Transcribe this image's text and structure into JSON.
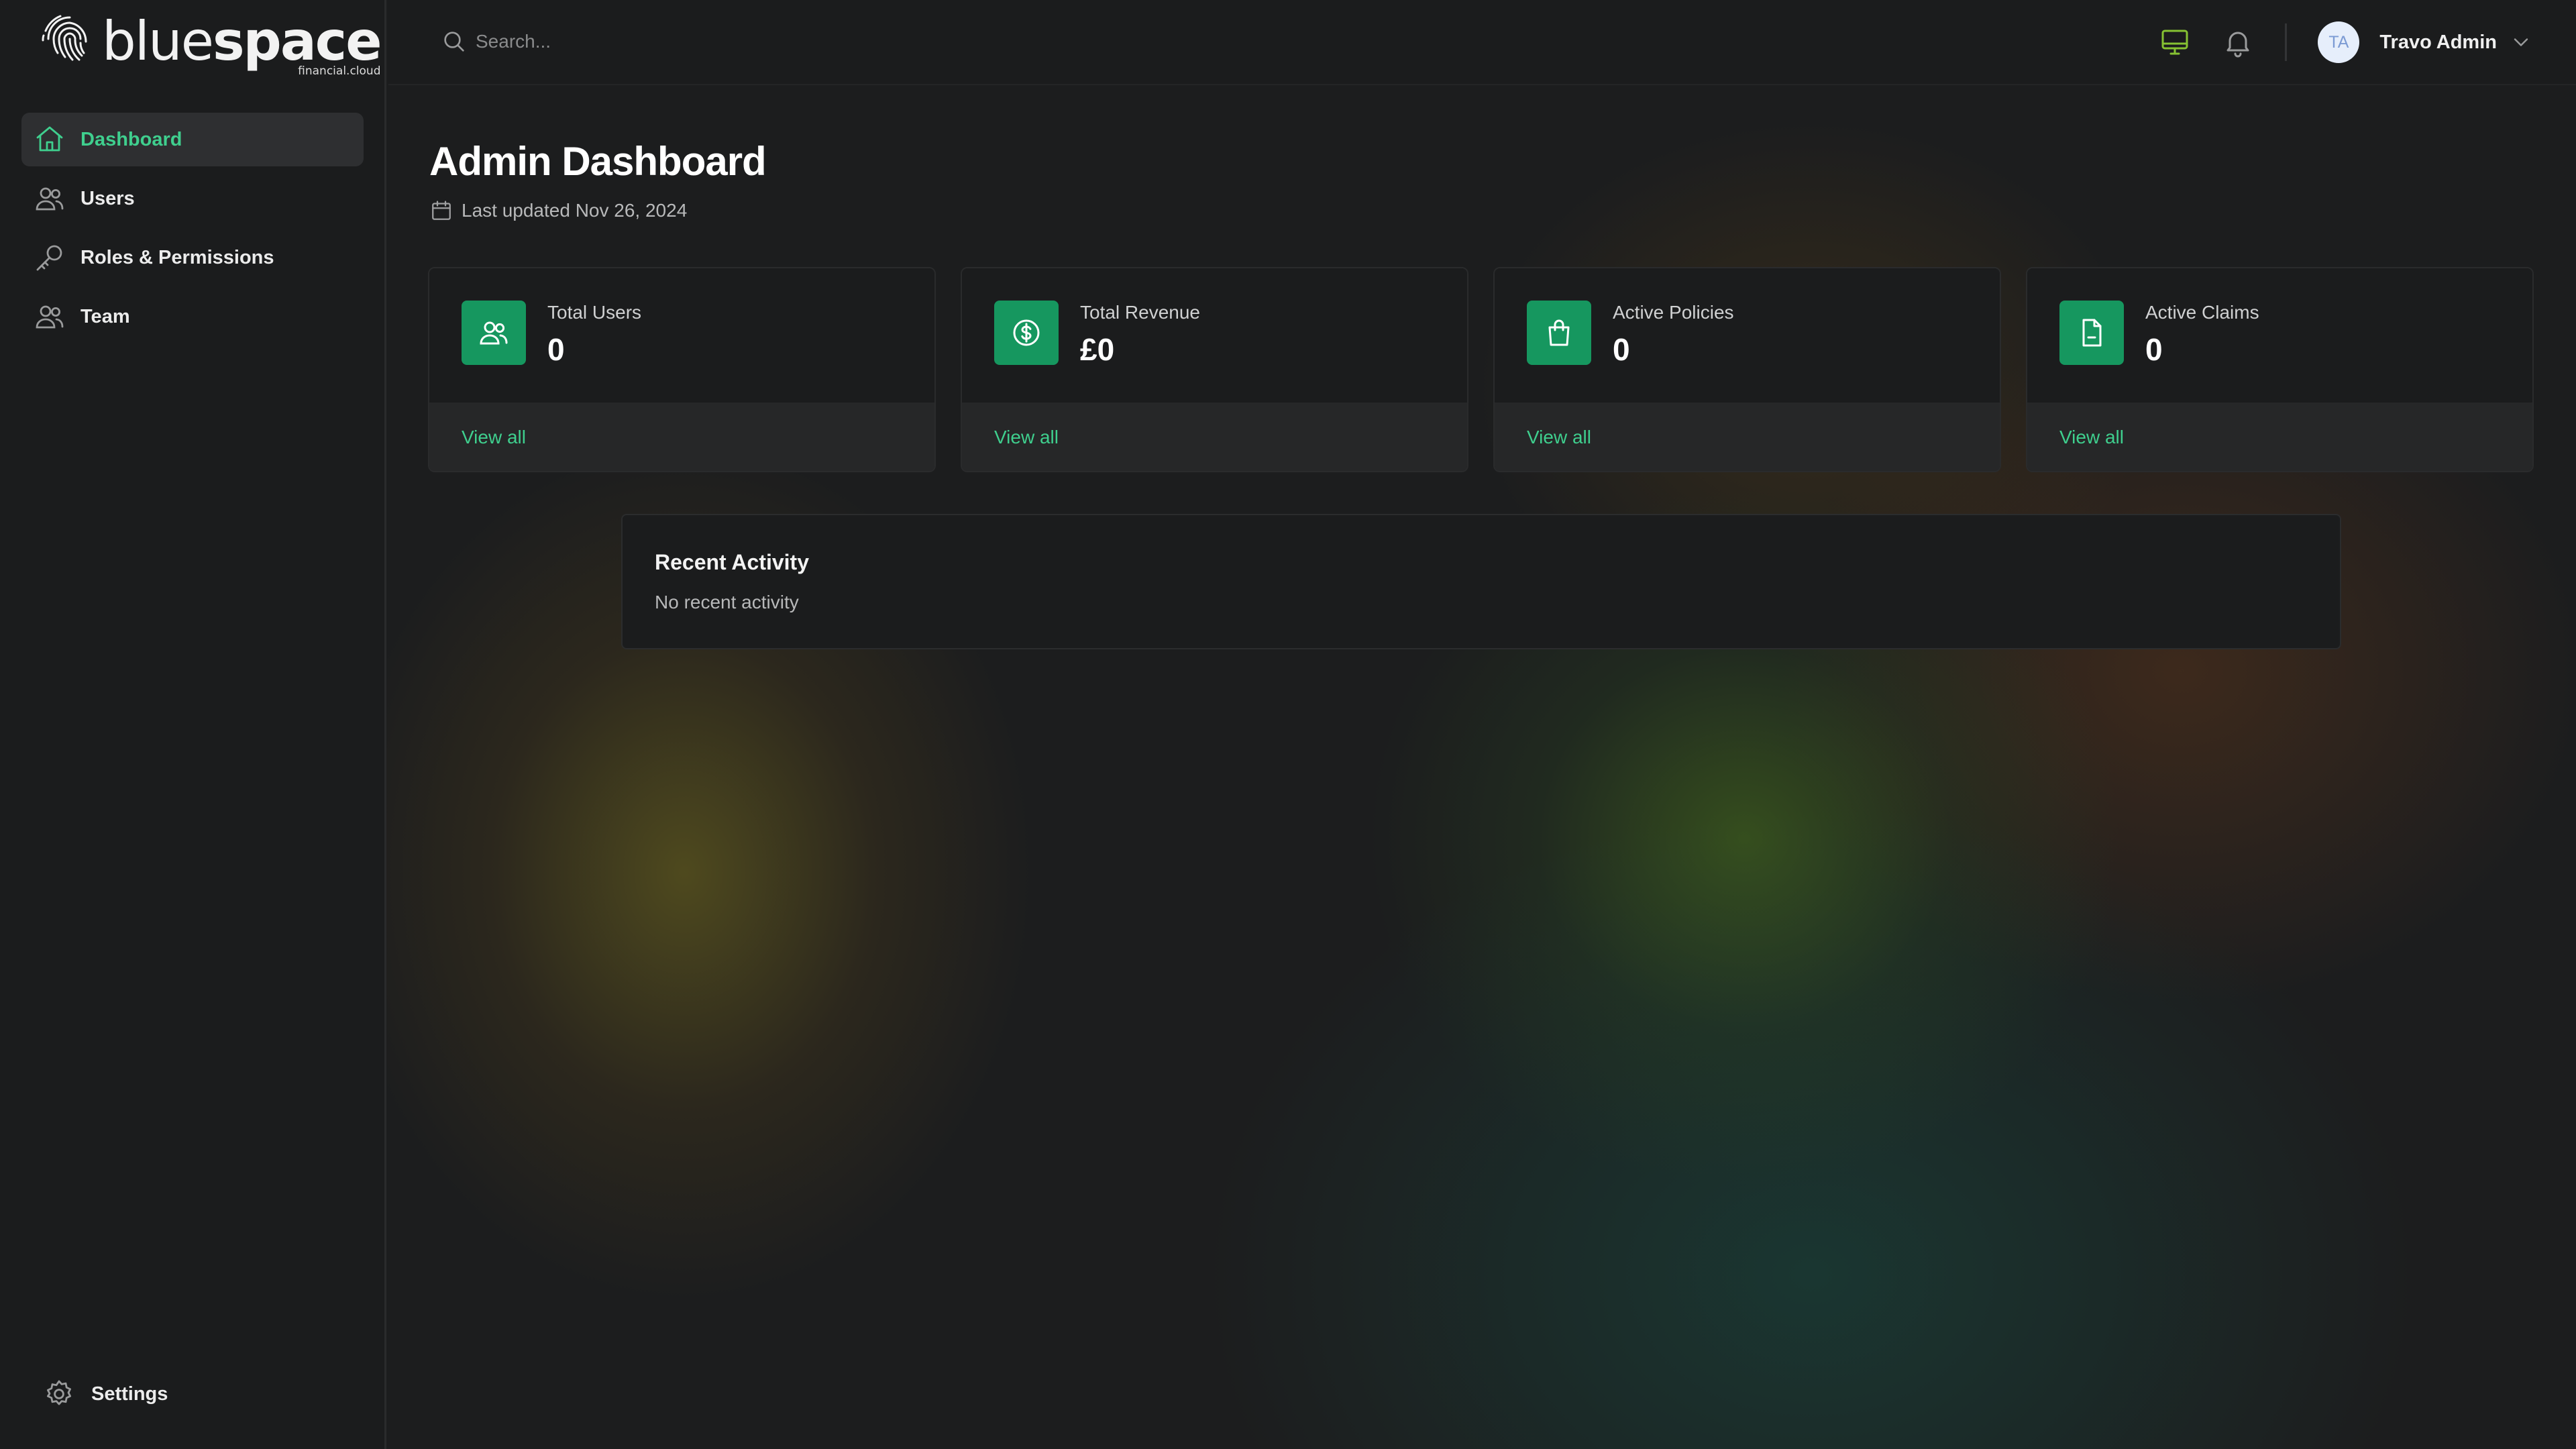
{
  "brand": {
    "logo_word_light": "blue",
    "logo_word_bold": "space",
    "logo_sub": "financial.cloud"
  },
  "sidebar": {
    "items": [
      {
        "label": "Dashboard",
        "icon": "home-icon",
        "active": true
      },
      {
        "label": "Users",
        "icon": "users-icon",
        "active": false
      },
      {
        "label": "Roles & Permissions",
        "icon": "key-icon",
        "active": false
      },
      {
        "label": "Team",
        "icon": "team-icon",
        "active": false
      }
    ],
    "settings_label": "Settings"
  },
  "topbar": {
    "search_placeholder": "Search...",
    "avatar_initials": "TA",
    "user_name": "Travo Admin"
  },
  "main": {
    "title": "Admin Dashboard",
    "last_updated": "Last updated Nov 26, 2024",
    "cards": [
      {
        "label": "Total Users",
        "value": "0",
        "link": "View all",
        "icon": "users-icon"
      },
      {
        "label": "Total Revenue",
        "value": "£0",
        "link": "View all",
        "icon": "dollar-icon"
      },
      {
        "label": "Active Policies",
        "value": "0",
        "link": "View all",
        "icon": "shopping-bag-icon"
      },
      {
        "label": "Active Claims",
        "value": "0",
        "link": "View all",
        "icon": "document-icon"
      }
    ],
    "activity": {
      "title": "Recent Activity",
      "empty_text": "No recent activity"
    }
  },
  "colors": {
    "accent": "#3fcf8e",
    "card_icon_bg": "#16975f",
    "background": "#1c1d1e",
    "sidebar_bg": "#1b1c1d"
  }
}
